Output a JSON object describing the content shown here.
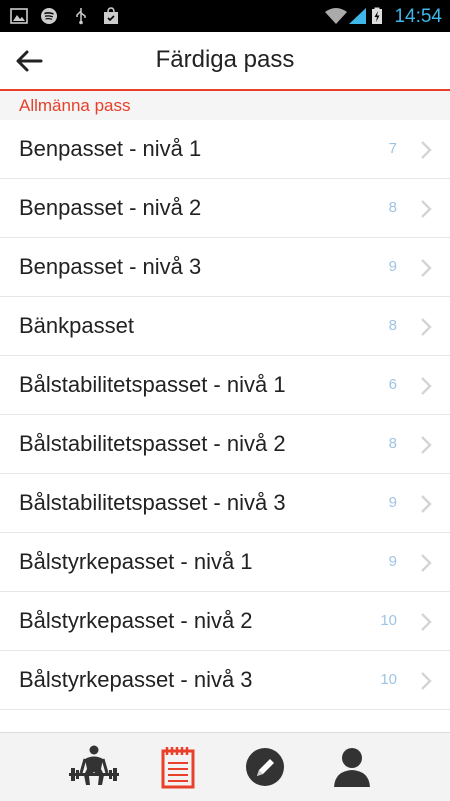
{
  "status": {
    "time": "14:54"
  },
  "header": {
    "title": "Färdiga pass"
  },
  "section": {
    "label": "Allmänna pass"
  },
  "items": [
    {
      "label": "Benpasset - nivå 1",
      "count": "7"
    },
    {
      "label": "Benpasset - nivå 2",
      "count": "8"
    },
    {
      "label": "Benpasset - nivå 3",
      "count": "9"
    },
    {
      "label": "Bänkpasset",
      "count": "8"
    },
    {
      "label": "Bålstabilitetspasset - nivå 1",
      "count": "6"
    },
    {
      "label": "Bålstabilitetspasset - nivå 2",
      "count": "8"
    },
    {
      "label": "Bålstabilitetspasset - nivå 3",
      "count": "9"
    },
    {
      "label": "Bålstyrkepasset - nivå 1",
      "count": "9"
    },
    {
      "label": "Bålstyrkepasset - nivå 2",
      "count": "10"
    },
    {
      "label": "Bålstyrkepasset - nivå 3",
      "count": "10"
    },
    {
      "label": "",
      "count": ""
    }
  ],
  "bottom_nav": [
    {
      "icon": "weightlifter-icon"
    },
    {
      "icon": "notepad-icon"
    },
    {
      "icon": "pencil-icon"
    },
    {
      "icon": "person-icon"
    }
  ],
  "colors": {
    "accent": "#e8402b",
    "count": "#9fc4e3",
    "time": "#3fb7e8"
  }
}
